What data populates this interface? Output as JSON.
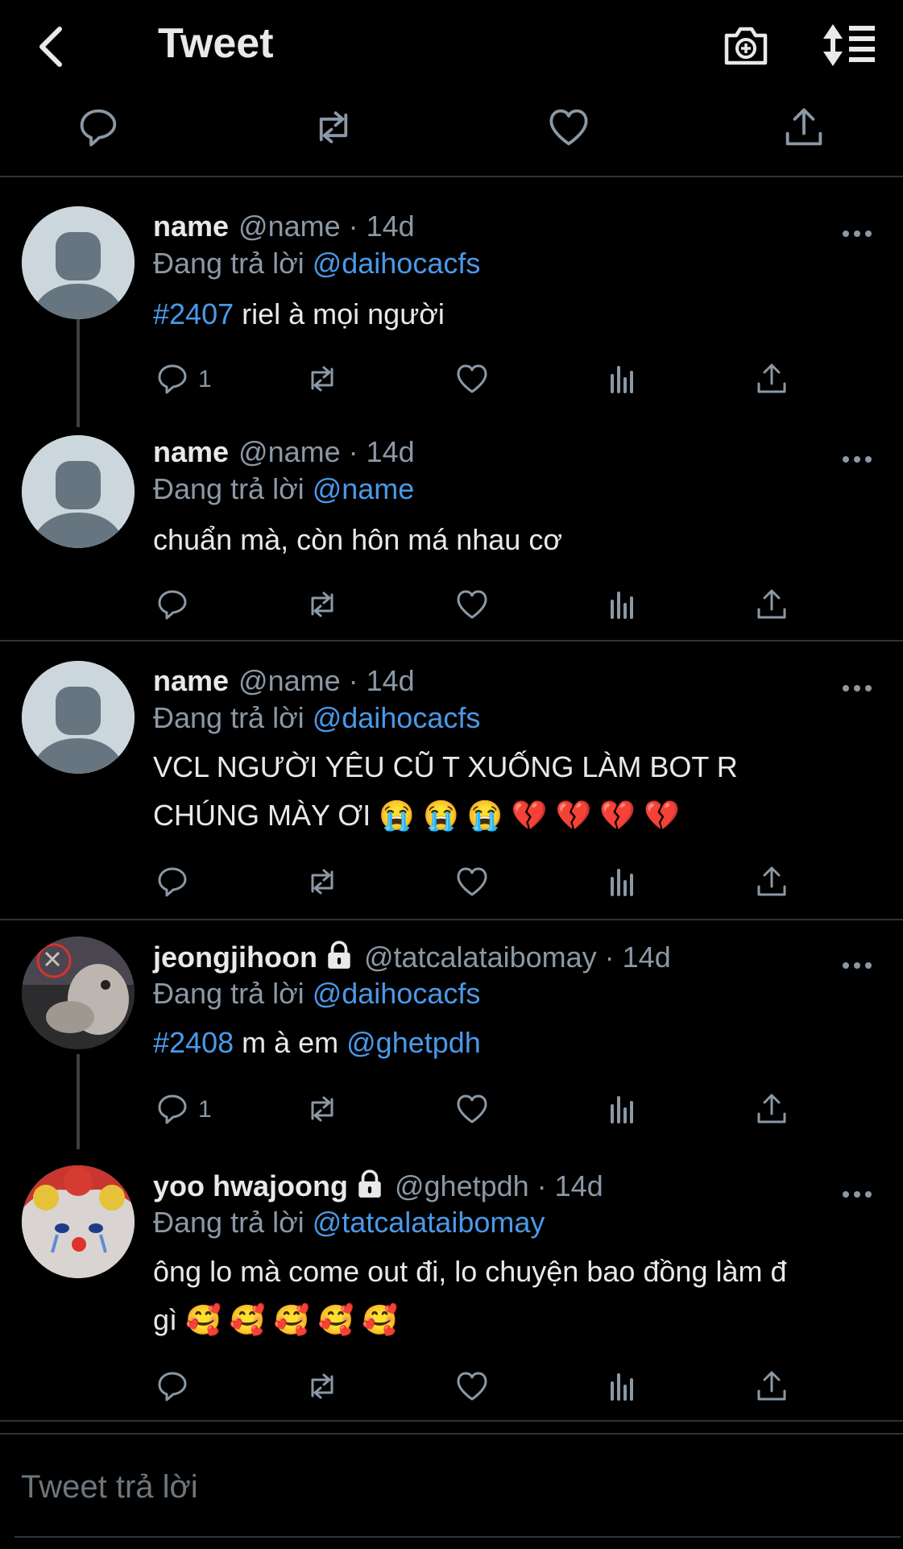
{
  "header": {
    "title": "Tweet"
  },
  "tweets": [
    {
      "name": "name",
      "handle": "@name · 14d",
      "reply_prefix": "Đang trả lời ",
      "reply_to": "@daihocacfs",
      "hashtag": "#2407",
      "text": " riel à mọi người",
      "reply_count": "1"
    },
    {
      "name": "name",
      "handle": "@name · 14d",
      "reply_prefix": "Đang trả lời ",
      "reply_to": "@name",
      "text": "chuẩn mà, còn hôn má nhau cơ",
      "reply_count": ""
    },
    {
      "name": "name",
      "handle": "@name · 14d",
      "reply_prefix": "Đang trả lời ",
      "reply_to": "@daihocacfs",
      "text_line1": "VCL NGƯỜI YÊU CŨ T XUỐNG LÀM BOT R",
      "text_line2": "CHÚNG MÀY ƠI 😭 😭 😭 💔 💔 💔 💔",
      "reply_count": ""
    },
    {
      "name": "jeongjihoon",
      "handle": "@tatcalataibomay · 14d",
      "reply_prefix": "Đang trả lời ",
      "reply_to": "@daihocacfs",
      "hashtag": "#2408",
      "text": " m à em ",
      "mention": "@ghetpdh",
      "reply_count": "1"
    },
    {
      "name": "yoo hwajoong",
      "handle": "@ghetpdh · 14d",
      "reply_prefix": "Đang trả lời ",
      "reply_to": "@tatcalataibomay",
      "text_line1": "ông lo mà come out đi, lo chuyện bao đồng làm đ",
      "text_line2": "gì 🥰 🥰 🥰 🥰 🥰",
      "reply_count": ""
    }
  ],
  "compose": {
    "placeholder": "Tweet trả lời"
  },
  "colors": {
    "background": "#000000",
    "link": "#4a99e9",
    "muted": "#8b98a5",
    "divider": "#2f3336"
  },
  "icons": [
    "back-arrow-icon",
    "camera-plus-icon",
    "sort-list-icon",
    "reply-icon",
    "retweet-icon",
    "like-icon",
    "analytics-icon",
    "share-icon",
    "more-icon",
    "lock-icon"
  ]
}
